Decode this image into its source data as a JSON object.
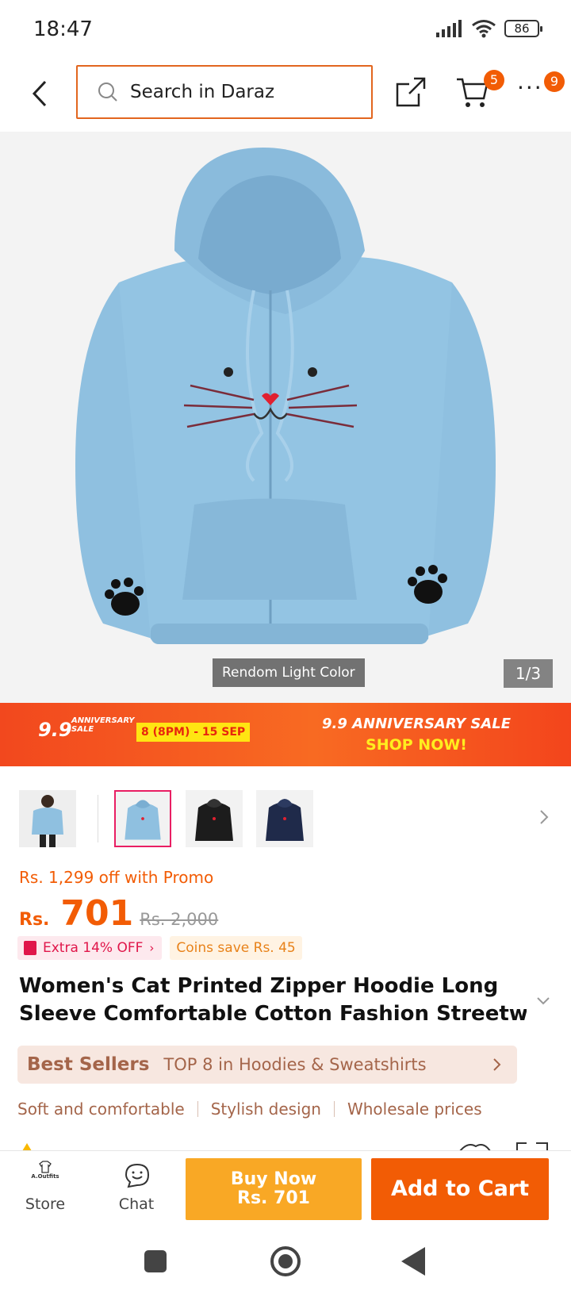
{
  "status_bar": {
    "time": "18:47",
    "battery": "86"
  },
  "header": {
    "search_placeholder": "Search in Daraz",
    "cart_count": "5",
    "more_count": "9"
  },
  "gallery": {
    "caption": "Rendom Light Color",
    "counter": "1/3"
  },
  "banner": {
    "logo_number": "9.9",
    "logo_text": "ANNIVERSARY SALE",
    "date": "8 (8PM) - 15 SEP",
    "title": "9.9 ANNIVERSARY SALE",
    "cta": "SHOP NOW!"
  },
  "thumbnails": [
    {
      "name": "model-light-blue"
    },
    {
      "name": "light-blue",
      "selected": true
    },
    {
      "name": "black"
    },
    {
      "name": "navy"
    }
  ],
  "price": {
    "promo": "Rs. 1,299 off with Promo",
    "currency": "Rs.",
    "value": "701",
    "original": "Rs. 2,000",
    "extra_tag": "Extra 14% OFF",
    "coins_tag": "Coins save Rs. 45"
  },
  "product": {
    "title_line1": "Women's Cat Printed Zipper Hoodie Long",
    "title_line2": "Sleeve Comfortable Cotton Fashion Streetw..."
  },
  "best_sellers": {
    "label": "Best Sellers",
    "text": "TOP 8 in Hoodies & Sweatshirts"
  },
  "features": [
    "Soft and comfortable",
    "Stylish design",
    "Wholesale prices"
  ],
  "bottom_bar": {
    "store_logo": "A.Outfits",
    "store_label": "Store",
    "chat_label": "Chat",
    "buy_now_label": "Buy Now",
    "buy_now_price": "Rs. 701",
    "add_to_cart_label": "Add to Cart"
  },
  "colors": {
    "brand_orange": "#f25c05",
    "buy_now": "#f9a825",
    "hoodie_blue": "#8fc0e0"
  }
}
